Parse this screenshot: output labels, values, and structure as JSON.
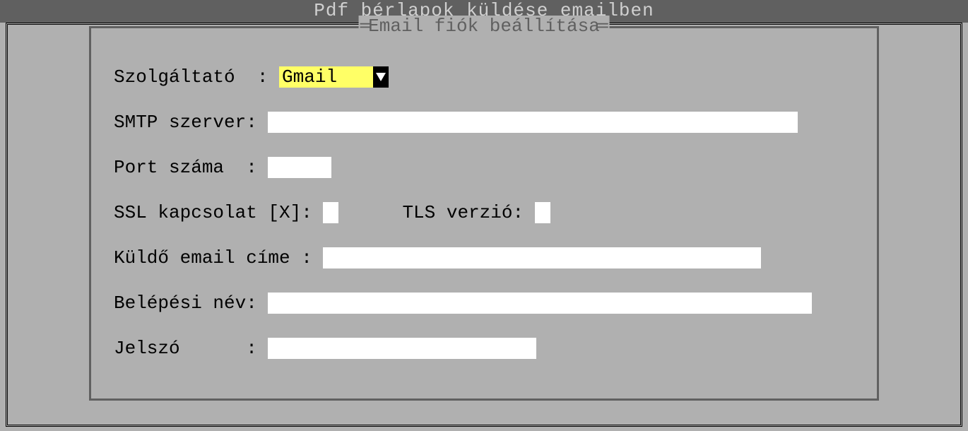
{
  "window": {
    "title": "Pdf bérlapok küldése emailben"
  },
  "panel": {
    "title": "Email fiók beállítása"
  },
  "labels": {
    "provider": "Szolgáltató  : ",
    "smtp": "SMTP szerver: ",
    "port": "Port száma  : ",
    "ssl": "SSL kapcsolat [X]: ",
    "tls": "TLS verzió: ",
    "sender": "Küldő email címe : ",
    "login": "Belépési név: ",
    "password": "Jelszó      : "
  },
  "values": {
    "provider": "Gmail   ",
    "smtp": "",
    "port": "",
    "ssl": "",
    "tls": "",
    "sender": "",
    "login": "",
    "password": ""
  },
  "widths": {
    "smtp": 750,
    "port": 90,
    "sender": 620,
    "login": 770,
    "password": 380
  }
}
